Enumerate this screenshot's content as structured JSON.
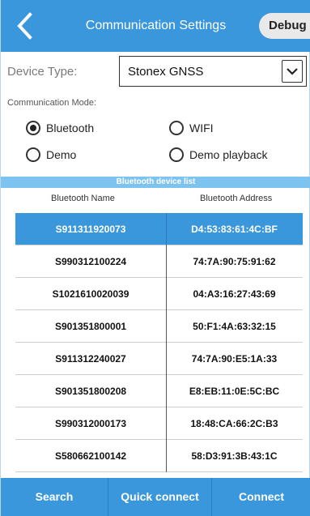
{
  "header": {
    "title": "Communication Settings",
    "back_icon": "chevron-left-icon",
    "debug_label": "Debug"
  },
  "device": {
    "label": "Device Type:",
    "selected": "Stonex GNSS",
    "arrow_icon": "chevron-down-icon"
  },
  "mode": {
    "label": "Communication Mode:",
    "options": [
      {
        "label": "Bluetooth",
        "checked": true
      },
      {
        "label": "WIFI",
        "checked": false
      },
      {
        "label": "Demo",
        "checked": false
      },
      {
        "label": "Demo playback",
        "checked": false
      }
    ]
  },
  "device_list": {
    "title": "Bluetooth device list",
    "col_name": "Bluetooth Name",
    "col_address": "Bluetooth Address",
    "rows": [
      {
        "name": "S911311920073",
        "address": "D4:53:83:61:4C:BF",
        "selected": true
      },
      {
        "name": "S990312100224",
        "address": "74:7A:90:75:91:62",
        "selected": false
      },
      {
        "name": "S1021610020039",
        "address": "04:A3:16:27:43:69",
        "selected": false
      },
      {
        "name": "S901351800001",
        "address": "50:F1:4A:63:32:15",
        "selected": false
      },
      {
        "name": "S911312240027",
        "address": "74:7A:90:E5:1A:33",
        "selected": false
      },
      {
        "name": "S901351800208",
        "address": "E8:EB:11:0E:5C:BC",
        "selected": false
      },
      {
        "name": "S990312000173",
        "address": "18:48:CA:66:2C:B3",
        "selected": false
      },
      {
        "name": "S580662100142",
        "address": "58:D3:91:3B:43:1C",
        "selected": false
      }
    ]
  },
  "footer": {
    "search": "Search",
    "quick_connect": "Quick connect",
    "connect": "Connect"
  },
  "colors": {
    "primary": "#3a97db",
    "list_title_bar": "#7cc3f0"
  }
}
